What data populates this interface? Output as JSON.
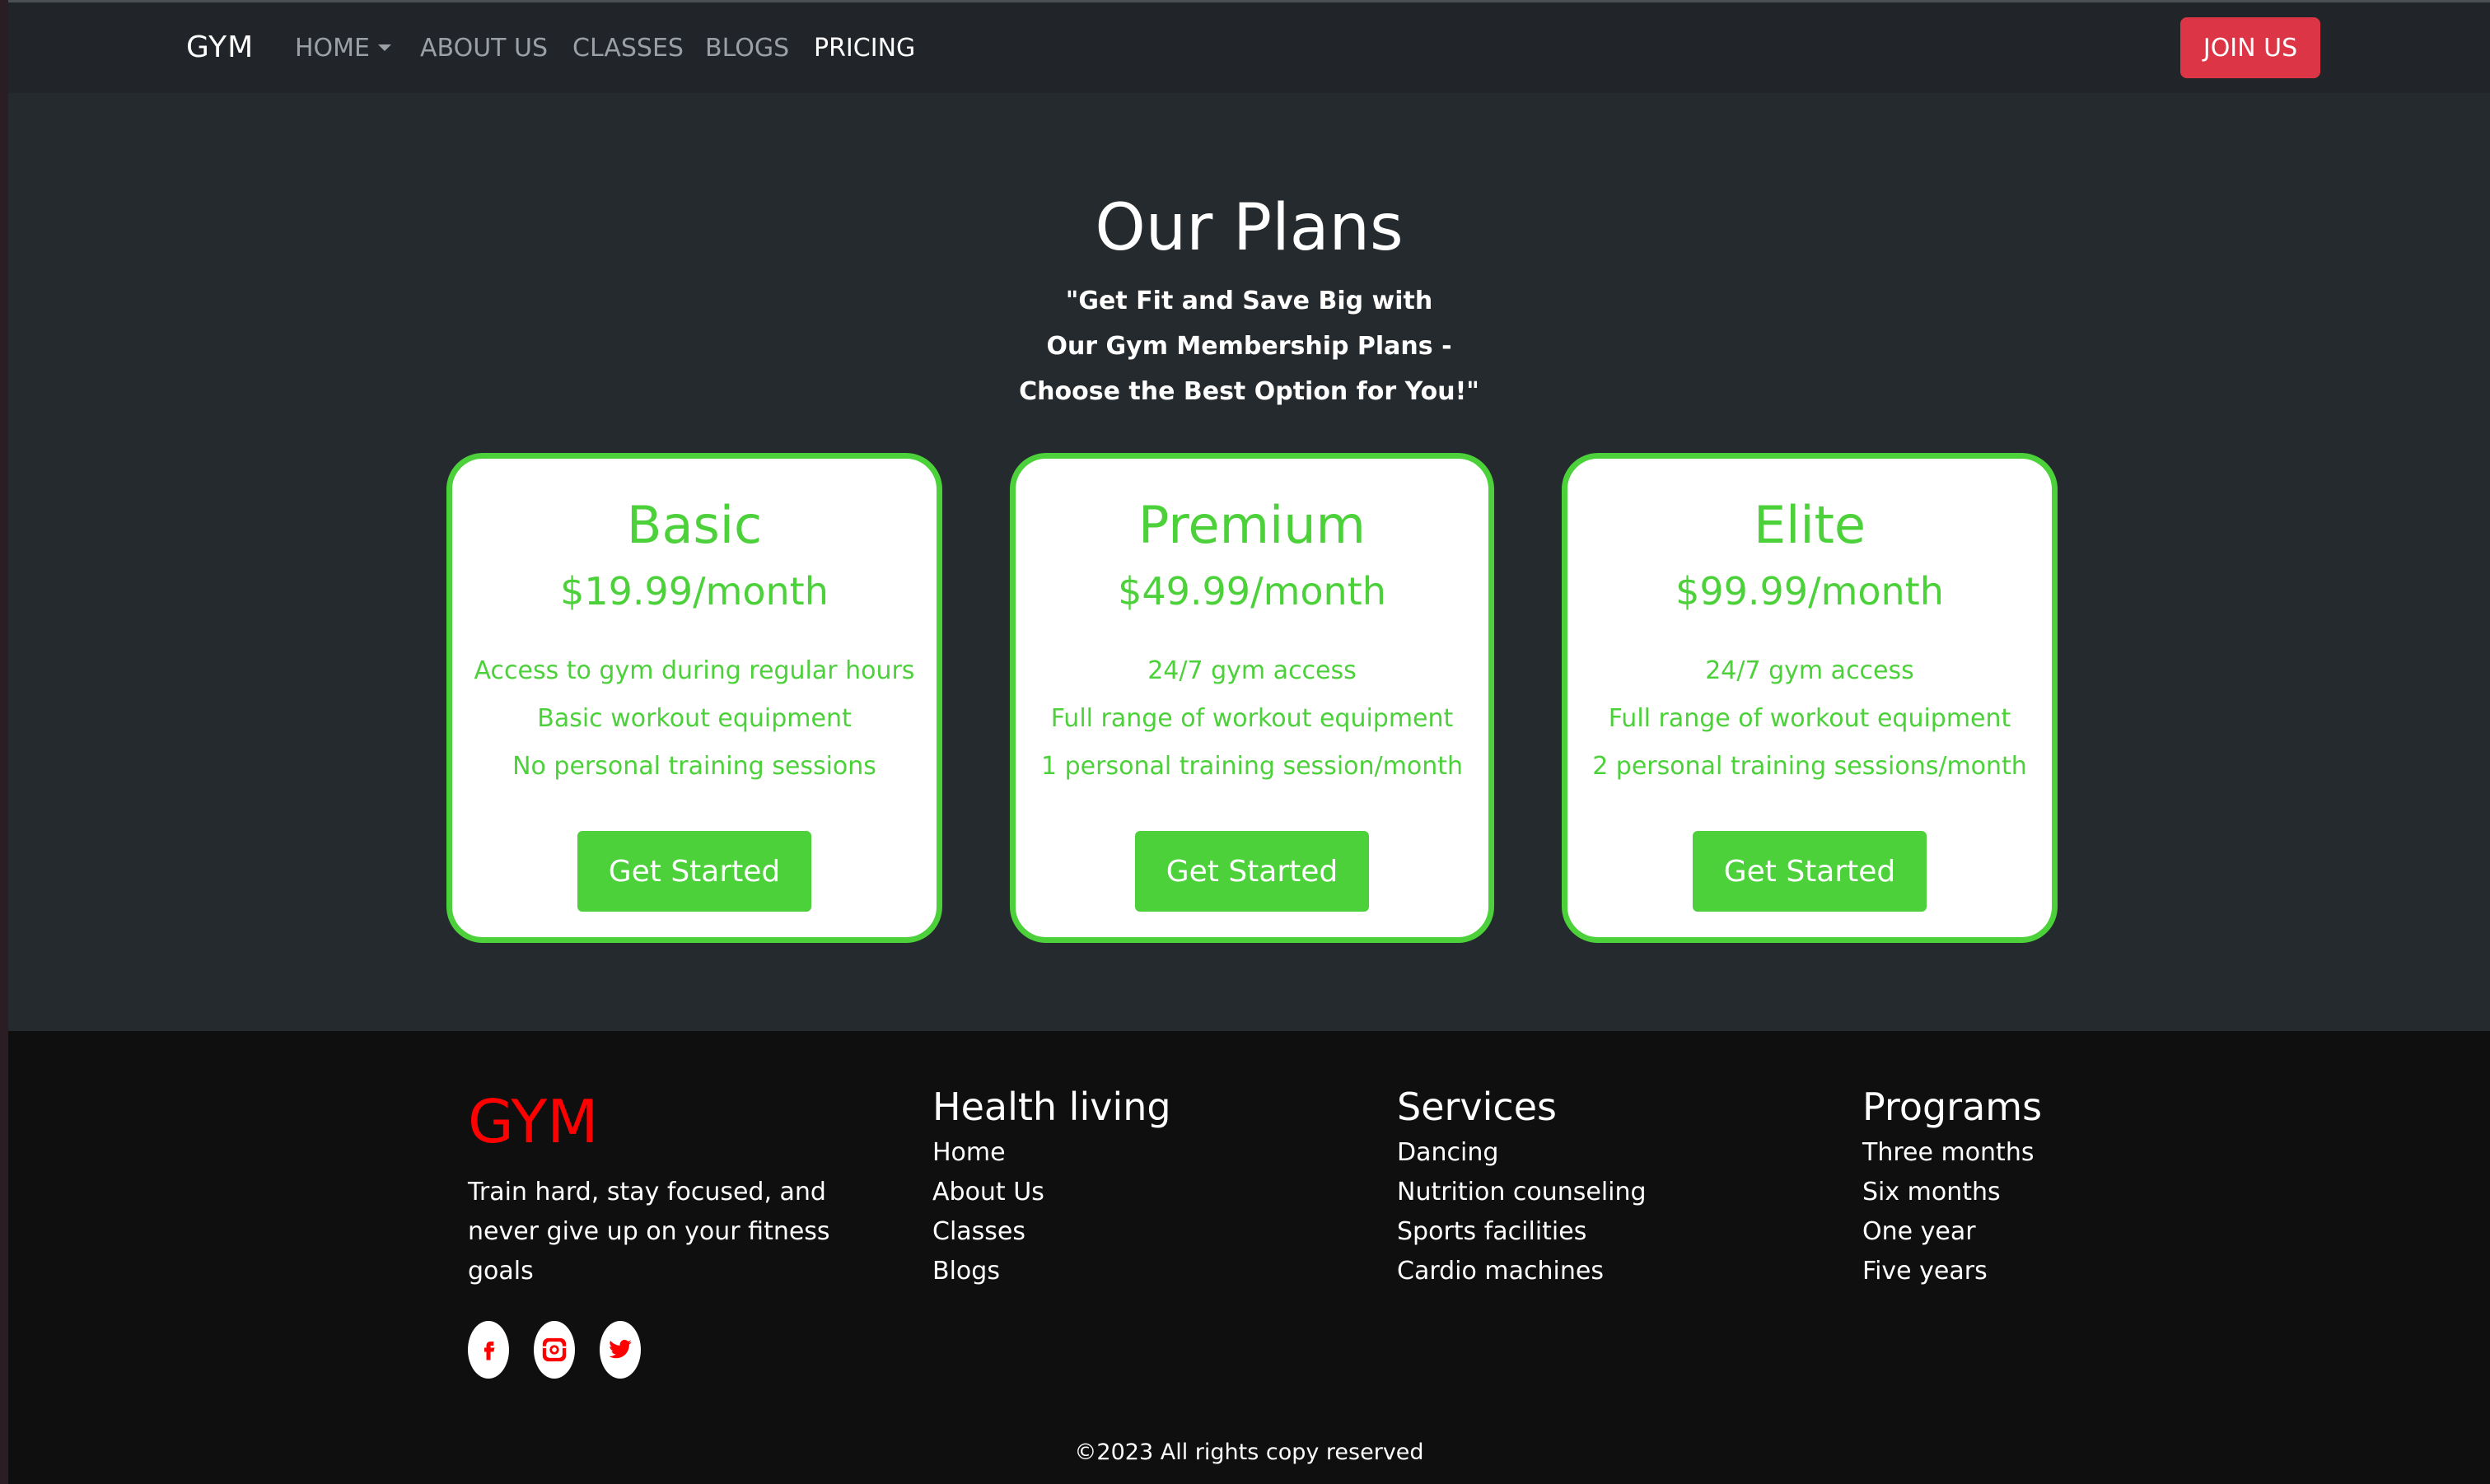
{
  "nav": {
    "brand": "GYM",
    "items": [
      {
        "label": "HOME"
      },
      {
        "label": "ABOUT US"
      },
      {
        "label": "CLASSES"
      },
      {
        "label": "BLOGS"
      },
      {
        "label": "PRICING"
      }
    ],
    "join_label": "JOIN US"
  },
  "plans": {
    "title": "Our Plans",
    "subtitle_lines": [
      "\"Get Fit and Save Big with",
      "Our Gym Membership Plans -",
      "Choose the Best Option for You!\""
    ],
    "cards": [
      {
        "name": "Basic",
        "price": "$19.99/month",
        "features": [
          "Access to gym during regular hours",
          "Basic workout equipment",
          "No personal training sessions"
        ],
        "button": "Get Started"
      },
      {
        "name": "Premium",
        "price": "$49.99/month",
        "features": [
          "24/7 gym access",
          "Full range of workout equipment",
          "1 personal training session/month"
        ],
        "button": "Get Started"
      },
      {
        "name": "Elite",
        "price": "$99.99/month",
        "features": [
          "24/7 gym access",
          "Full range of workout equipment",
          "2 personal training sessions/month"
        ],
        "button": "Get Started"
      }
    ]
  },
  "footer": {
    "logo": "GYM",
    "tagline": "Train hard, stay focused, and never give up on your fitness goals",
    "social": [
      "facebook-icon",
      "instagram-icon",
      "twitter-icon"
    ],
    "columns": [
      {
        "title": "Health living",
        "links": [
          "Home",
          "About Us",
          "Classes",
          "Blogs"
        ]
      },
      {
        "title": "Services",
        "links": [
          "Dancing",
          "Nutrition counseling",
          "Sports facilities",
          "Cardio machines"
        ]
      },
      {
        "title": "Programs",
        "links": [
          "Three months",
          "Six months",
          "One year",
          "Five years"
        ]
      }
    ],
    "copyright": "©2023 All rights copy reserved"
  },
  "colors": {
    "accent_green": "#4cd13b",
    "join_red": "#dc3545",
    "logo_red": "#ff0000",
    "navbar": "#212529",
    "section_bg": "#242a2d",
    "footer_bg": "#0f0f0f"
  }
}
